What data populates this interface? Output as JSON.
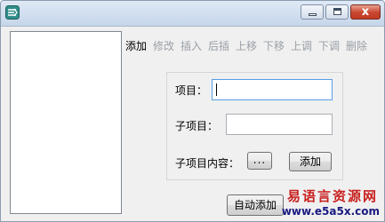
{
  "window": {
    "title": "",
    "controls": {
      "minimize_icon": "minimize-icon",
      "maximize_icon": "maximize-icon",
      "close_label": "x"
    }
  },
  "listbox": {
    "items": []
  },
  "toolbar": {
    "items": [
      {
        "label": "添加",
        "active": true
      },
      {
        "label": "修改",
        "active": false
      },
      {
        "label": "插入",
        "active": false
      },
      {
        "label": "后插",
        "active": false
      },
      {
        "label": "上移",
        "active": false
      },
      {
        "label": "下移",
        "active": false
      },
      {
        "label": "上调",
        "active": false
      },
      {
        "label": "下调",
        "active": false
      },
      {
        "label": "删除",
        "active": false
      }
    ]
  },
  "form": {
    "item_label": "项目：",
    "item_value": "",
    "subitem_label": "子项目：",
    "subitem_value": "",
    "subitem_content_label": "子项目内容：",
    "browse_label": "...",
    "add_label": "添加"
  },
  "auto_add_label": "自动添加",
  "watermark": {
    "text": "易语言资源网",
    "url": "www.e5a5x.com"
  },
  "colors": {
    "active_text": "#000000",
    "inactive_text": "#9aa0a6",
    "focus_border": "#569de5",
    "close_button": "#c8452f"
  }
}
